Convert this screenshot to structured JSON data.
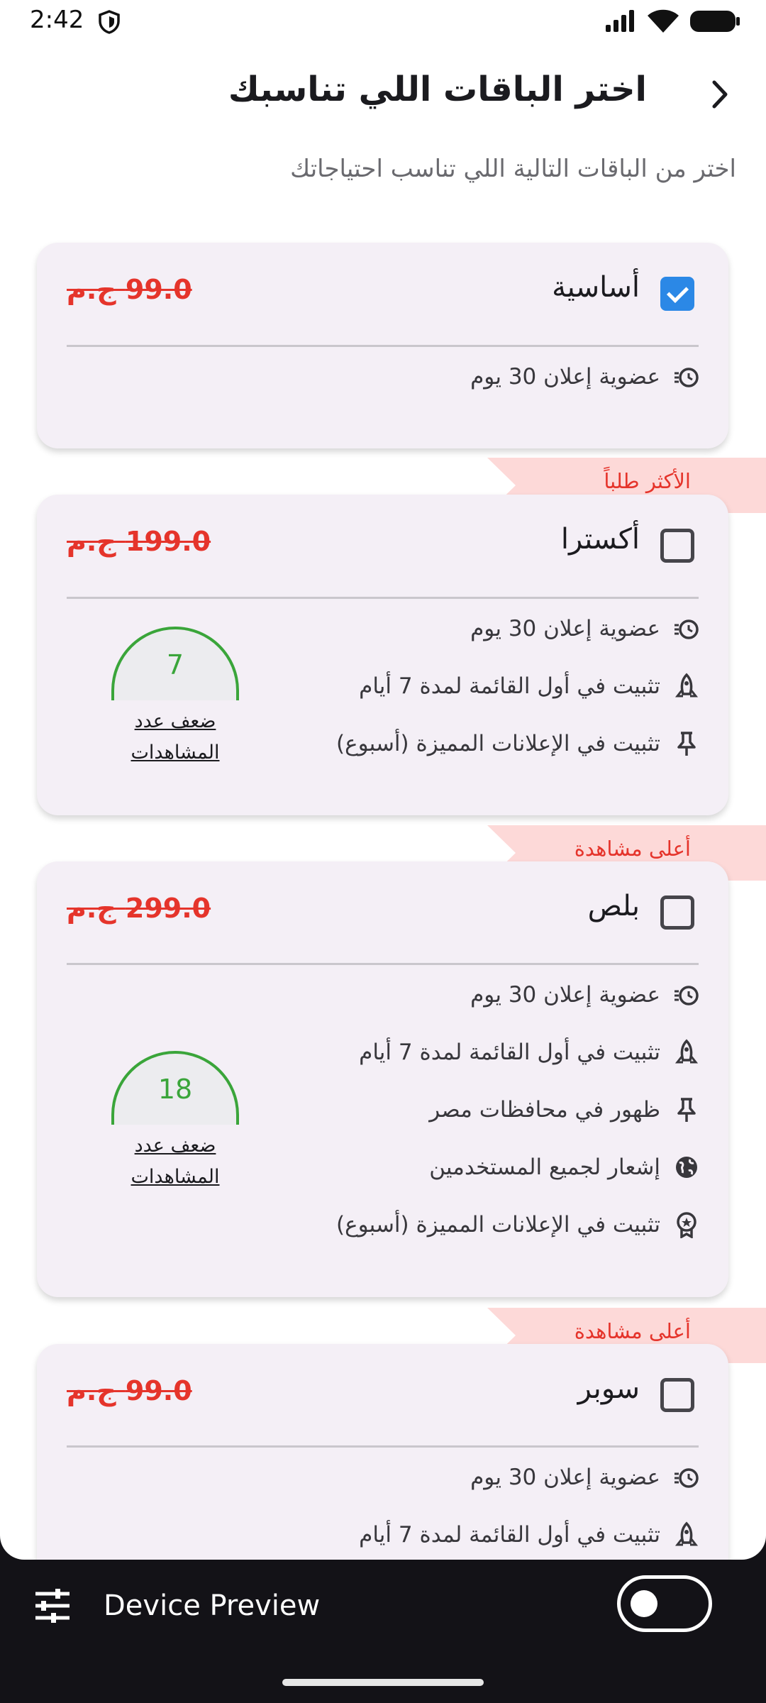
{
  "status_bar": {
    "time": "2:42"
  },
  "header": {
    "title": "اختر الباقات اللي تناسبك",
    "subtitle": "اختر من الباقات التالية اللي تناسب احتياجاتك"
  },
  "packages": [
    {
      "name": "أساسية",
      "price": "99.0 ج.م",
      "checked": true,
      "features": [
        {
          "text": "عضوية إعلان 30 يوم",
          "icon": "timer-icon"
        }
      ]
    },
    {
      "name": "أكسترا",
      "price": "199.0 ج.م",
      "checked": false,
      "ribbon": "الأكثر طلباً",
      "views_multiplier": "7",
      "views_label": "ضعف عدد المشاهدات",
      "features": [
        {
          "text": "عضوية إعلان 30 يوم",
          "icon": "timer-icon"
        },
        {
          "text": "تثبيت في أول القائمة لمدة 7 أيام",
          "icon": "rocket-icon"
        },
        {
          "text": "تثبيت في الإعلانات المميزة (أسبوع)",
          "icon": "pin-icon"
        }
      ]
    },
    {
      "name": "بلص",
      "price": "299.0 ج.م",
      "checked": false,
      "ribbon": "أعلى مشاهدة",
      "views_multiplier": "18",
      "views_label": "ضعف عدد المشاهدات",
      "features": [
        {
          "text": "عضوية إعلان 30 يوم",
          "icon": "timer-icon"
        },
        {
          "text": "تثبيت في أول القائمة لمدة 7 أيام",
          "icon": "rocket-icon"
        },
        {
          "text": "ظهور في محافظات مصر",
          "icon": "pin-icon"
        },
        {
          "text": "إشعار لجميع المستخدمين",
          "icon": "globe-icon"
        },
        {
          "text": "تثبيت في الإعلانات المميزة (أسبوع)",
          "icon": "badge-icon"
        }
      ]
    },
    {
      "name": "سوبر",
      "price": "99.0 ج.م",
      "checked": false,
      "ribbon": "أعلى مشاهدة",
      "features": [
        {
          "text": "عضوية إعلان 30 يوم",
          "icon": "timer-icon"
        },
        {
          "text": "تثبيت في أول القائمة لمدة 7 أيام",
          "icon": "rocket-icon"
        }
      ]
    }
  ],
  "device_preview": {
    "label": "Device Preview",
    "toggle_on": false
  },
  "colors": {
    "price_red": "#e5342b",
    "ribbon_bg": "#fdd9d8",
    "card_bg": "#f4eff6",
    "checkbox_blue": "#2b88e6",
    "views_green": "#3aa53a"
  }
}
